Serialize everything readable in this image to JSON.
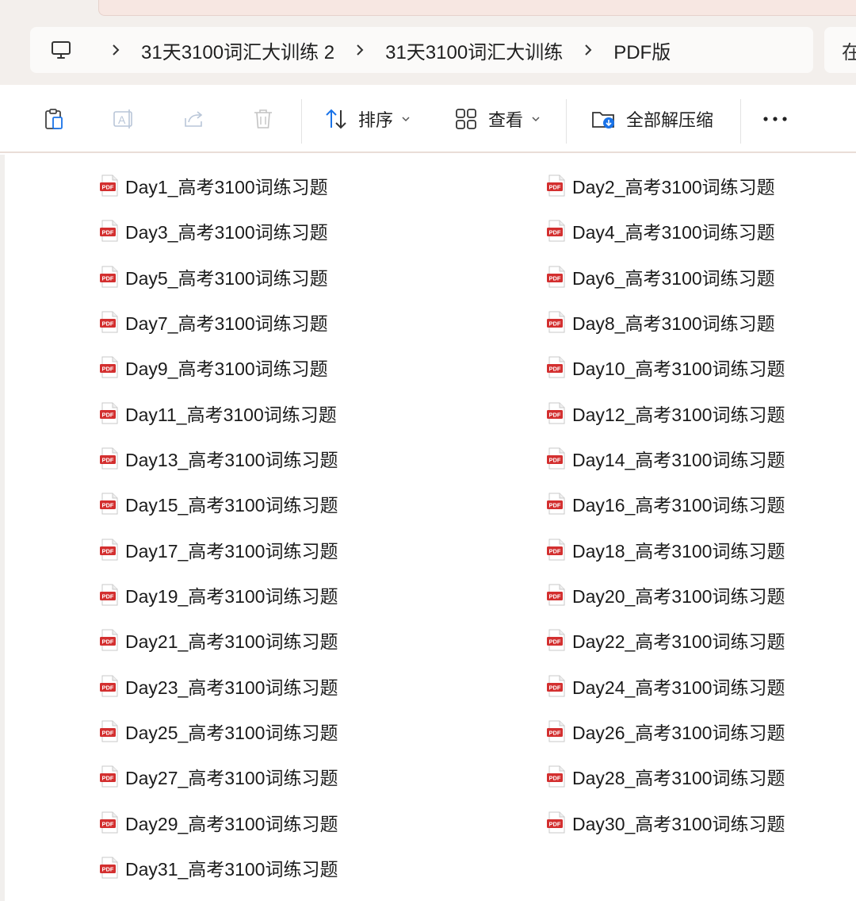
{
  "breadcrumb": {
    "items": [
      "31天3100词汇大训练 2",
      "31天3100词汇大训练",
      "PDF版"
    ],
    "search_stub_text": "在"
  },
  "toolbar": {
    "sort_label": "排序",
    "view_label": "查看",
    "extract_label": "全部解压缩"
  },
  "files": [
    {
      "name": "Day1_高考3100词练习题"
    },
    {
      "name": "Day2_高考3100词练习题"
    },
    {
      "name": "Day3_高考3100词练习题"
    },
    {
      "name": "Day4_高考3100词练习题"
    },
    {
      "name": "Day5_高考3100词练习题"
    },
    {
      "name": "Day6_高考3100词练习题"
    },
    {
      "name": "Day7_高考3100词练习题"
    },
    {
      "name": "Day8_高考3100词练习题"
    },
    {
      "name": "Day9_高考3100词练习题"
    },
    {
      "name": "Day10_高考3100词练习题"
    },
    {
      "name": "Day11_高考3100词练习题"
    },
    {
      "name": "Day12_高考3100词练习题"
    },
    {
      "name": "Day13_高考3100词练习题"
    },
    {
      "name": "Day14_高考3100词练习题"
    },
    {
      "name": "Day15_高考3100词练习题"
    },
    {
      "name": "Day16_高考3100词练习题"
    },
    {
      "name": "Day17_高考3100词练习题"
    },
    {
      "name": "Day18_高考3100词练习题"
    },
    {
      "name": "Day19_高考3100词练习题"
    },
    {
      "name": "Day20_高考3100词练习题"
    },
    {
      "name": "Day21_高考3100词练习题"
    },
    {
      "name": "Day22_高考3100词练习题"
    },
    {
      "name": "Day23_高考3100词练习题"
    },
    {
      "name": "Day24_高考3100词练习题"
    },
    {
      "name": "Day25_高考3100词练习题"
    },
    {
      "name": "Day26_高考3100词练习题"
    },
    {
      "name": "Day27_高考3100词练习题"
    },
    {
      "name": "Day28_高考3100词练习题"
    },
    {
      "name": "Day29_高考3100词练习题"
    },
    {
      "name": "Day30_高考3100词练习题"
    },
    {
      "name": "Day31_高考3100词练习题"
    }
  ],
  "file_icon": {
    "name": "pdf-file-icon",
    "badge_text": "PDF",
    "color": "#d32f2f"
  },
  "colors": {
    "chrome_bg": "#f3efec",
    "accent_blue": "#1a73e8"
  }
}
